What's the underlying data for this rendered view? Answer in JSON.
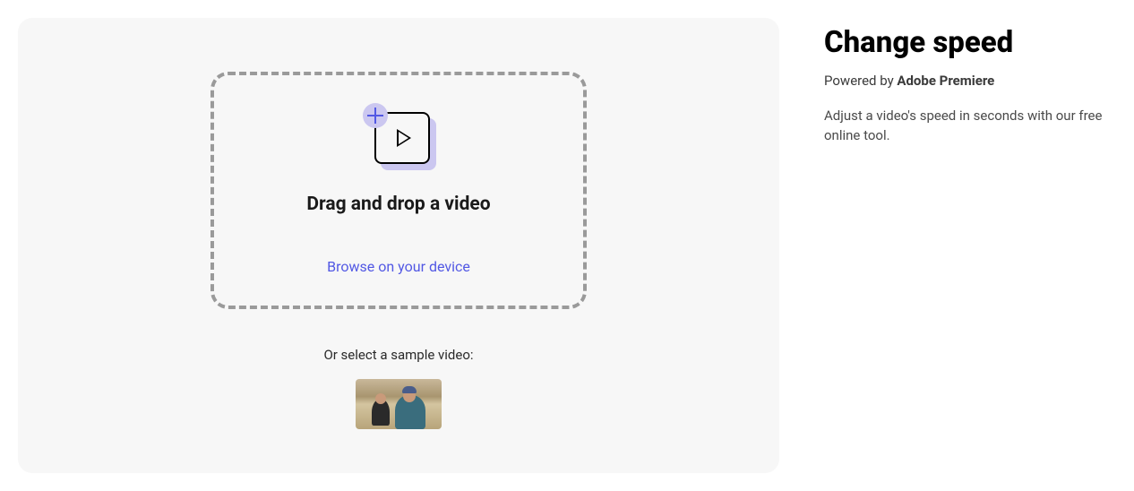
{
  "main": {
    "dropzone": {
      "title": "Drag and drop a video",
      "browse": "Browse on your device"
    },
    "sampleLabel": "Or select a sample video:"
  },
  "side": {
    "title": "Change speed",
    "poweredPrefix": "Powered by ",
    "poweredBrand": "Adobe Premiere",
    "description": "Adjust a video's speed in seconds with our free online tool."
  }
}
